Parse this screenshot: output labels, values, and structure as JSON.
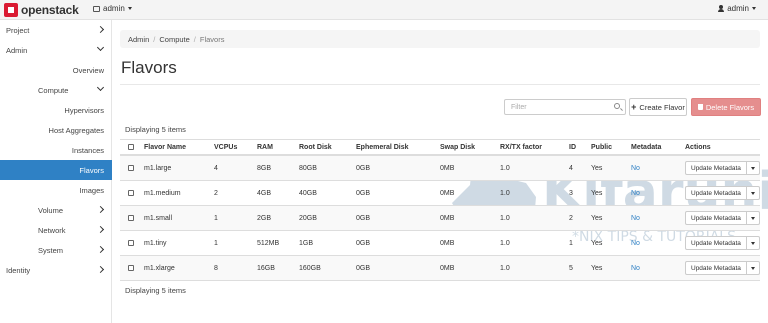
{
  "brand": {
    "name": "openstack"
  },
  "topbar": {
    "project_label": "admin",
    "user_label": "admin"
  },
  "sidebar": {
    "items": [
      {
        "label": "Project",
        "level": 0,
        "chevron": "right"
      },
      {
        "label": "Admin",
        "level": 0,
        "chevron": "down"
      },
      {
        "label": "Overview",
        "level": 2
      },
      {
        "label": "Compute",
        "level": 1,
        "chevron": "down"
      },
      {
        "label": "Hypervisors",
        "level": 2
      },
      {
        "label": "Host Aggregates",
        "level": 2
      },
      {
        "label": "Instances",
        "level": 2
      },
      {
        "label": "Flavors",
        "level": 2,
        "active": true
      },
      {
        "label": "Images",
        "level": 2
      },
      {
        "label": "Volume",
        "level": 1,
        "chevron": "right"
      },
      {
        "label": "Network",
        "level": 1,
        "chevron": "right"
      },
      {
        "label": "System",
        "level": 1,
        "chevron": "right"
      },
      {
        "label": "Identity",
        "level": 0,
        "chevron": "right"
      }
    ]
  },
  "breadcrumb": {
    "items": [
      "Admin",
      "Compute",
      "Flavors"
    ]
  },
  "page": {
    "title": "Flavors"
  },
  "toolbar": {
    "filter_placeholder": "Filter",
    "create_label": "Create Flavor",
    "delete_label": "Delete Flavors"
  },
  "table": {
    "count_top": "Displaying 5 items",
    "count_bottom": "Displaying 5 items",
    "headers": [
      "Flavor Name",
      "VCPUs",
      "RAM",
      "Root Disk",
      "Ephemeral Disk",
      "Swap Disk",
      "RX/TX factor",
      "ID",
      "Public",
      "Metadata",
      "Actions"
    ],
    "rows": [
      {
        "name": "m1.large",
        "vcpus": "4",
        "ram": "8GB",
        "root_disk": "80GB",
        "ephemeral": "0GB",
        "swap": "0MB",
        "rxtx": "1.0",
        "id": "4",
        "public": "Yes",
        "metadata": "No",
        "action": "Update Metadata"
      },
      {
        "name": "m1.medium",
        "vcpus": "2",
        "ram": "4GB",
        "root_disk": "40GB",
        "ephemeral": "0GB",
        "swap": "0MB",
        "rxtx": "1.0",
        "id": "3",
        "public": "Yes",
        "metadata": "No",
        "action": "Update Metadata"
      },
      {
        "name": "m1.small",
        "vcpus": "1",
        "ram": "2GB",
        "root_disk": "20GB",
        "ephemeral": "0GB",
        "swap": "0MB",
        "rxtx": "1.0",
        "id": "2",
        "public": "Yes",
        "metadata": "No",
        "action": "Update Metadata"
      },
      {
        "name": "m1.tiny",
        "vcpus": "1",
        "ram": "512MB",
        "root_disk": "1GB",
        "ephemeral": "0GB",
        "swap": "0MB",
        "rxtx": "1.0",
        "id": "1",
        "public": "Yes",
        "metadata": "No",
        "action": "Update Metadata"
      },
      {
        "name": "m1.xlarge",
        "vcpus": "8",
        "ram": "16GB",
        "root_disk": "160GB",
        "ephemeral": "0GB",
        "swap": "0MB",
        "rxtx": "1.0",
        "id": "5",
        "public": "Yes",
        "metadata": "No",
        "action": "Update Metadata"
      }
    ]
  },
  "watermark": {
    "title": "Kifarunix",
    "tagline": "*NIX TIPS & TUTORIALS"
  },
  "colors": {
    "accent": "#2f81c5",
    "brand_red": "#da1a32",
    "danger": "#e58e8e",
    "watermark": "#2a5d86"
  }
}
